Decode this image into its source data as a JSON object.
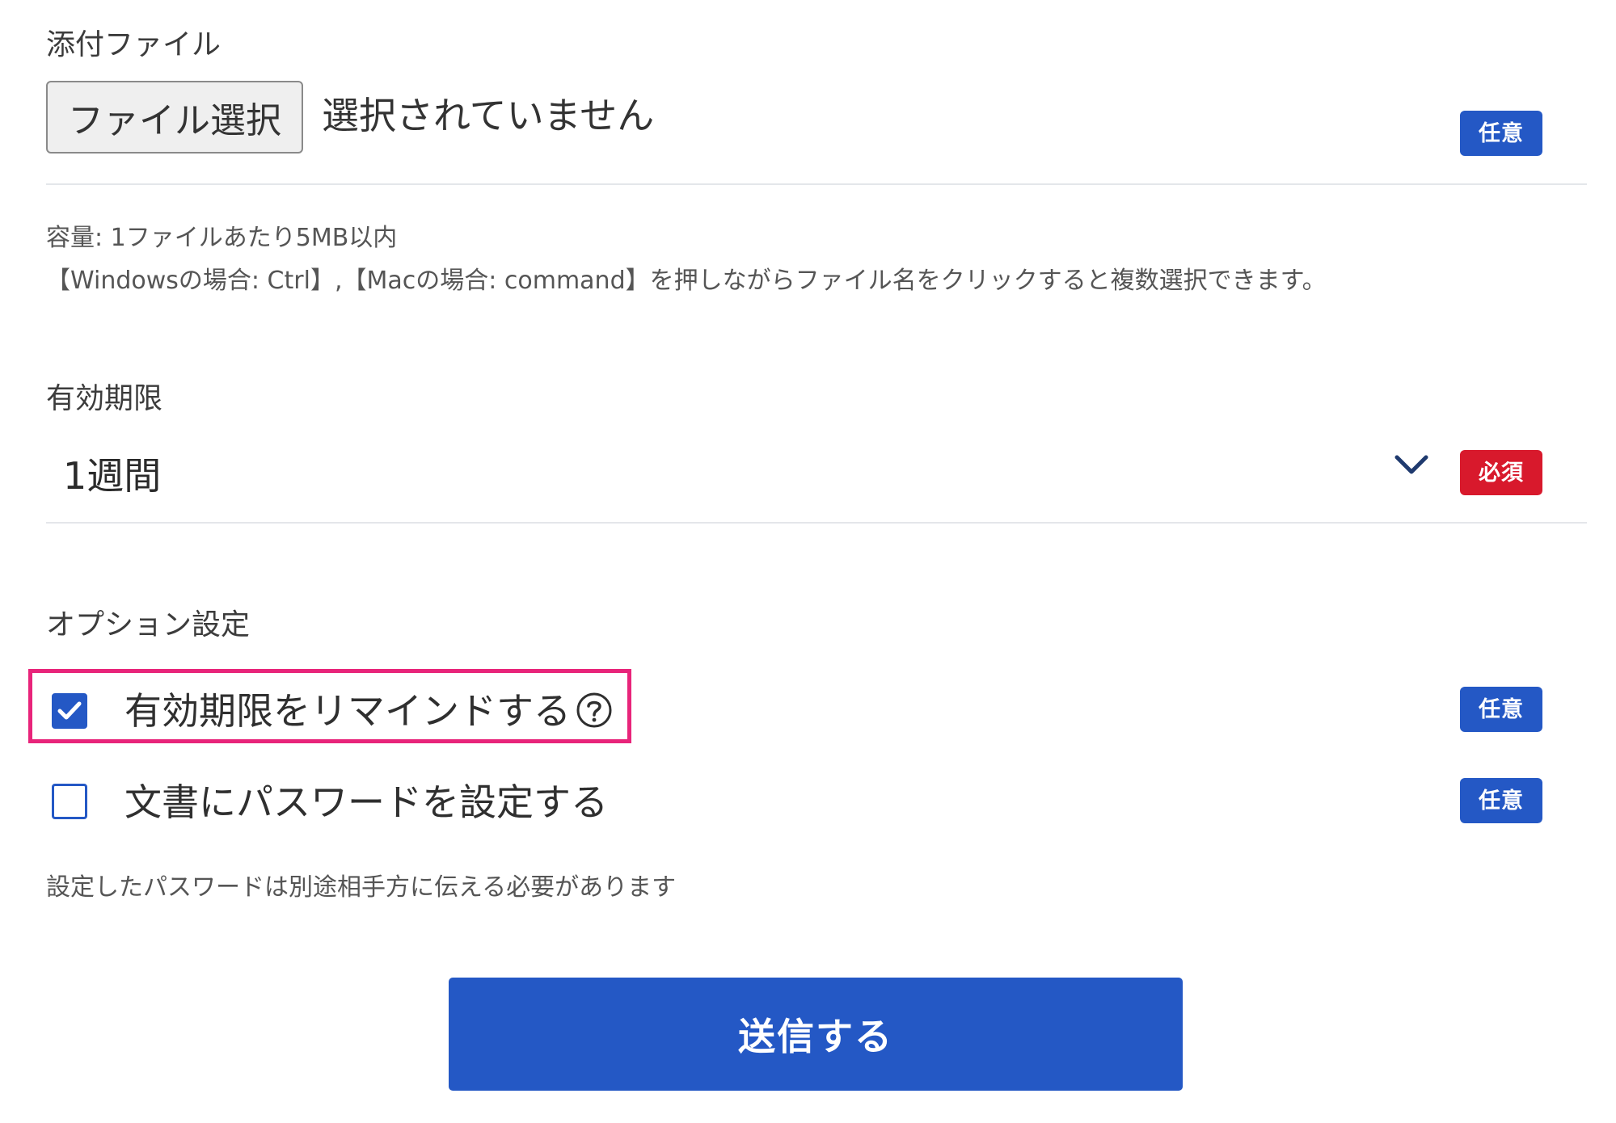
{
  "attachment": {
    "label": "添付ファイル",
    "button_label": "ファイル選択",
    "status": "選択されていません",
    "badge": "任意",
    "help_size": "容量: 1ファイルあたり5MB以内",
    "help_multi": "【Windowsの場合: Ctrl】,【Macの場合: command】を押しながらファイル名をクリックすると複数選択できます。"
  },
  "expiry": {
    "label": "有効期限",
    "selected_value": "1週間",
    "badge": "必須"
  },
  "options": {
    "label": "オプション設定",
    "items": [
      {
        "label": "有効期限をリマインドする",
        "checked": true,
        "badge": "任意",
        "has_help_icon": true,
        "highlighted": true
      },
      {
        "label": "文書にパスワードを設定する",
        "checked": false,
        "badge": "任意",
        "has_help_icon": false,
        "highlighted": false
      }
    ],
    "password_note": "設定したパスワードは別途相手方に伝える必要があります"
  },
  "submit": {
    "label": "送信する"
  },
  "colors": {
    "primary": "#2458c5",
    "required": "#d8192c",
    "highlight": "#e8247a",
    "divider": "#e4e6ea"
  },
  "icons": {
    "chevron": "chevron-down-icon",
    "help": "question-circle-icon",
    "check": "checkmark-icon"
  }
}
